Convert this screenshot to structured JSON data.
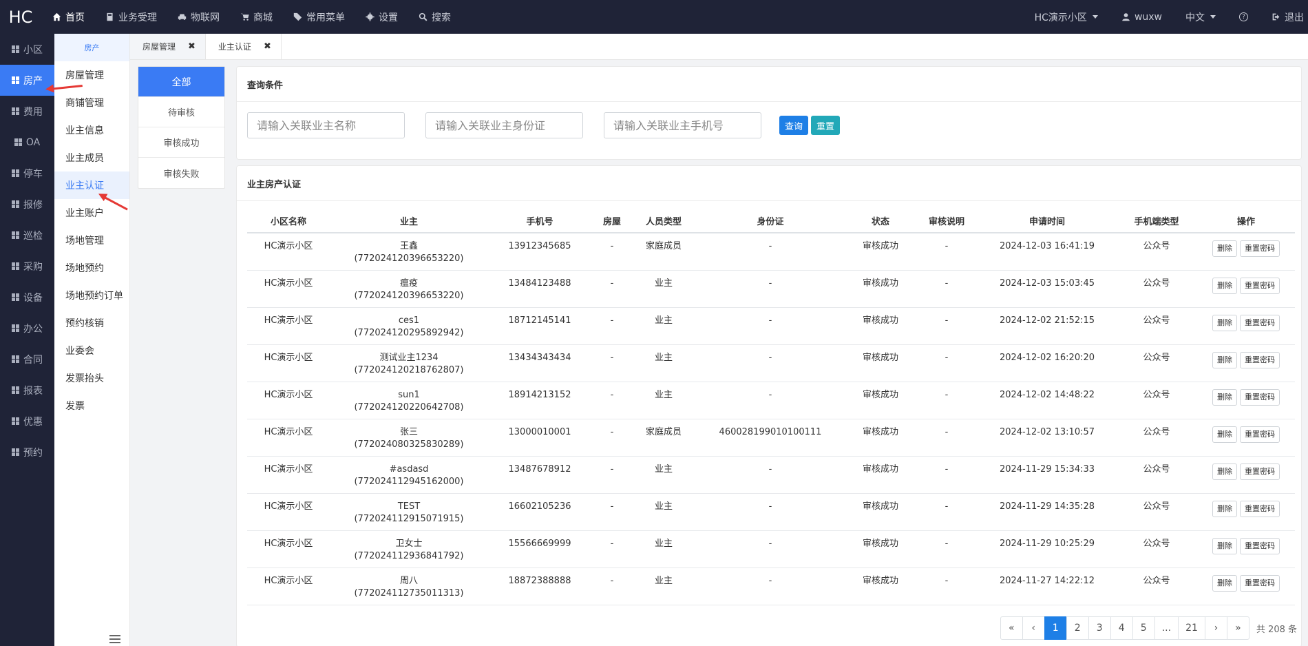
{
  "topbar": {
    "logo": "HC",
    "nav": [
      {
        "label": "首页",
        "icon": "home-icon"
      },
      {
        "label": "业务受理",
        "icon": "calculator-icon"
      },
      {
        "label": "物联网",
        "icon": "car-icon"
      },
      {
        "label": "商城",
        "icon": "cart-icon"
      },
      {
        "label": "常用菜单",
        "icon": "tags-icon"
      },
      {
        "label": "设置",
        "icon": "gear-icon"
      },
      {
        "label": "搜索",
        "icon": "search-icon"
      }
    ],
    "community": "HC演示小区",
    "user": "wuxw",
    "language": "中文",
    "help": "?",
    "logout": "退出"
  },
  "sidebar1": {
    "items": [
      "小区",
      "房产",
      "费用",
      "OA",
      "停车",
      "报修",
      "巡检",
      "采购",
      "设备",
      "办公",
      "合同",
      "报表",
      "优惠",
      "预约"
    ]
  },
  "sidebar2": {
    "header": "房产",
    "items": [
      "房屋管理",
      "商铺管理",
      "业主信息",
      "业主成员",
      "业主认证",
      "业主账户",
      "场地管理",
      "场地预约",
      "场地预约订单",
      "预约核销",
      "业委会",
      "发票抬头",
      "发票"
    ]
  },
  "tabs": [
    {
      "label": "房屋管理",
      "close": "✖"
    },
    {
      "label": "业主认证",
      "close": "✖"
    }
  ],
  "filter": {
    "items": [
      "全部",
      "待审核",
      "审核成功",
      "审核失败"
    ]
  },
  "query": {
    "title": "查询条件",
    "name_placeholder": "请输入关联业主名称",
    "id_placeholder": "请输入关联业主身份证",
    "phone_placeholder": "请输入关联业主手机号",
    "search_label": "查询",
    "reset_label": "重置"
  },
  "table": {
    "title": "业主房产认证",
    "headers": [
      "小区名称",
      "业主",
      "手机号",
      "房屋",
      "人员类型",
      "身份证",
      "状态",
      "审核说明",
      "申请时间",
      "手机端类型",
      "操作"
    ],
    "delete_label": "删除",
    "reset_pwd_label": "重置密码",
    "rows": [
      {
        "community": "HC演示小区",
        "owner": "王鑫",
        "owner_id": "(772024120396653220)",
        "phone": "13912345685",
        "room": "-",
        "type": "家庭成员",
        "idcard": "-",
        "status": "审核成功",
        "note": "-",
        "time": "2024-12-03 16:41:19",
        "client": "公众号"
      },
      {
        "community": "HC演示小区",
        "owner": "瘟疫",
        "owner_id": "(772024120396653220)",
        "phone": "13484123488",
        "room": "-",
        "type": "业主",
        "idcard": "-",
        "status": "审核成功",
        "note": "-",
        "time": "2024-12-03 15:03:45",
        "client": "公众号"
      },
      {
        "community": "HC演示小区",
        "owner": "ces1",
        "owner_id": "(772024120295892942)",
        "phone": "18712145141",
        "room": "-",
        "type": "业主",
        "idcard": "-",
        "status": "审核成功",
        "note": "-",
        "time": "2024-12-02 21:52:15",
        "client": "公众号"
      },
      {
        "community": "HC演示小区",
        "owner": "测试业主1234",
        "owner_id": "(772024120218762807)",
        "phone": "13434343434",
        "room": "-",
        "type": "业主",
        "idcard": "-",
        "status": "审核成功",
        "note": "-",
        "time": "2024-12-02 16:20:20",
        "client": "公众号"
      },
      {
        "community": "HC演示小区",
        "owner": "sun1",
        "owner_id": "(772024120220642708)",
        "phone": "18914213152",
        "room": "-",
        "type": "业主",
        "idcard": "-",
        "status": "审核成功",
        "note": "-",
        "time": "2024-12-02 14:48:22",
        "client": "公众号"
      },
      {
        "community": "HC演示小区",
        "owner": "张三",
        "owner_id": "(772024080325830289)",
        "phone": "13000010001",
        "room": "-",
        "type": "家庭成员",
        "idcard": "460028199010100111",
        "status": "审核成功",
        "note": "-",
        "time": "2024-12-02 13:10:57",
        "client": "公众号"
      },
      {
        "community": "HC演示小区",
        "owner": "#asdasd",
        "owner_id": "(772024112945162000)",
        "phone": "13487678912",
        "room": "-",
        "type": "业主",
        "idcard": "-",
        "status": "审核成功",
        "note": "-",
        "time": "2024-11-29 15:34:33",
        "client": "公众号"
      },
      {
        "community": "HC演示小区",
        "owner": "TEST",
        "owner_id": "(772024112915071915)",
        "phone": "16602105236",
        "room": "-",
        "type": "业主",
        "idcard": "-",
        "status": "审核成功",
        "note": "-",
        "time": "2024-11-29 14:35:28",
        "client": "公众号"
      },
      {
        "community": "HC演示小区",
        "owner": "卫女士",
        "owner_id": "(772024112936841792)",
        "phone": "15566669999",
        "room": "-",
        "type": "业主",
        "idcard": "-",
        "status": "审核成功",
        "note": "-",
        "time": "2024-11-29 10:25:29",
        "client": "公众号"
      },
      {
        "community": "HC演示小区",
        "owner": "周八",
        "owner_id": "(772024112735011313)",
        "phone": "18872388888",
        "room": "-",
        "type": "业主",
        "idcard": "-",
        "status": "审核成功",
        "note": "-",
        "time": "2024-11-27 14:22:12",
        "client": "公众号"
      }
    ]
  },
  "pagination": {
    "first": "«",
    "prev": "‹",
    "pages": [
      "1",
      "2",
      "3",
      "4",
      "5",
      "...",
      "21"
    ],
    "next": "›",
    "last": "»",
    "total": "共 208 条"
  },
  "colors": {
    "topbar": "#1f2337",
    "accent": "#3a7bf4",
    "search_button": "#1e7fe6",
    "reset_button": "#22a8b8",
    "annotation_arrow": "#e53935"
  }
}
